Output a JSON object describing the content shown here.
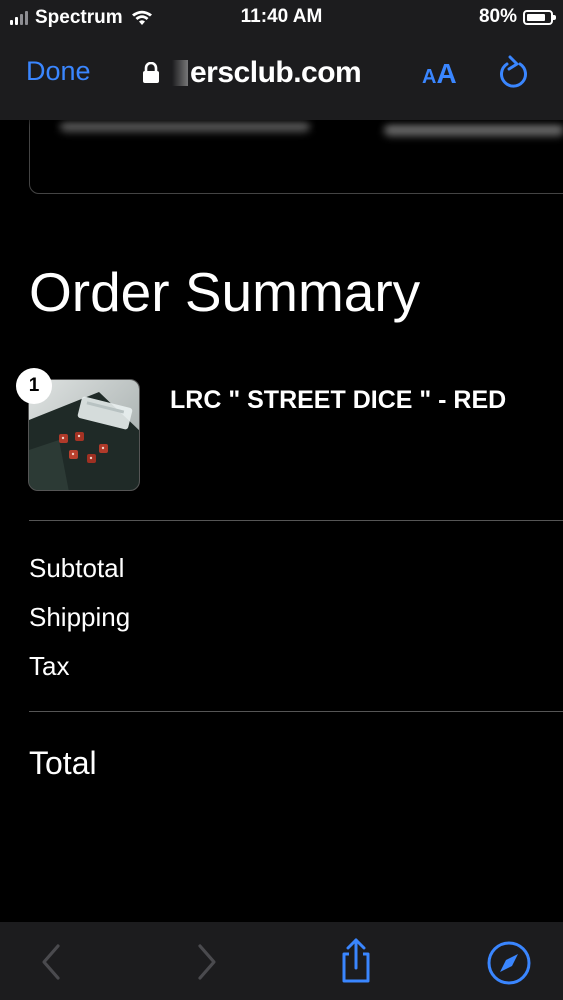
{
  "status_bar": {
    "carrier": "Spectrum",
    "time": "11:40 AM",
    "battery": "80%",
    "battery_level": 0.8
  },
  "browser": {
    "done_label": "Done",
    "address": "ersclub.com",
    "text_size_small": "A",
    "text_size_big": "A",
    "icons": [
      "lock-icon",
      "reload-icon",
      "back-icon",
      "forward-icon",
      "share-icon",
      "compass-icon"
    ]
  },
  "order": {
    "title": "Order Summary",
    "items": [
      {
        "quantity": "1",
        "name": "LRC \" STREET DICE \" - RED"
      }
    ],
    "labels": {
      "subtotal": "Subtotal",
      "shipping": "Shipping",
      "tax": "Tax",
      "total": "Total"
    }
  },
  "colors": {
    "accent": "#3a86ff",
    "background": "#000000",
    "chrome": "#1c1c1e"
  }
}
